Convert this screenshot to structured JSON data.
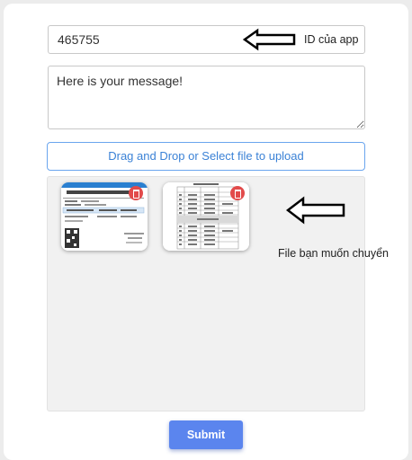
{
  "form": {
    "id_value": "465755",
    "message_value": "Here is your message!",
    "upload_label": "Drag and Drop or Select file to upload",
    "submit_label": "Submit"
  },
  "annotations": {
    "id_note": "ID của app",
    "file_note": "File bạn muốn chuyển"
  },
  "files": [
    {
      "icon": "document-thumbnail-registration-form",
      "delete_icon": "trash-icon"
    },
    {
      "icon": "document-thumbnail-table",
      "delete_icon": "trash-icon"
    }
  ],
  "colors": {
    "accent": "#5b85ee",
    "upload_border": "#6aa5ee",
    "upload_text": "#3b82d6",
    "delete": "#e24b4b",
    "dropzone_bg": "#f1f1f1"
  }
}
